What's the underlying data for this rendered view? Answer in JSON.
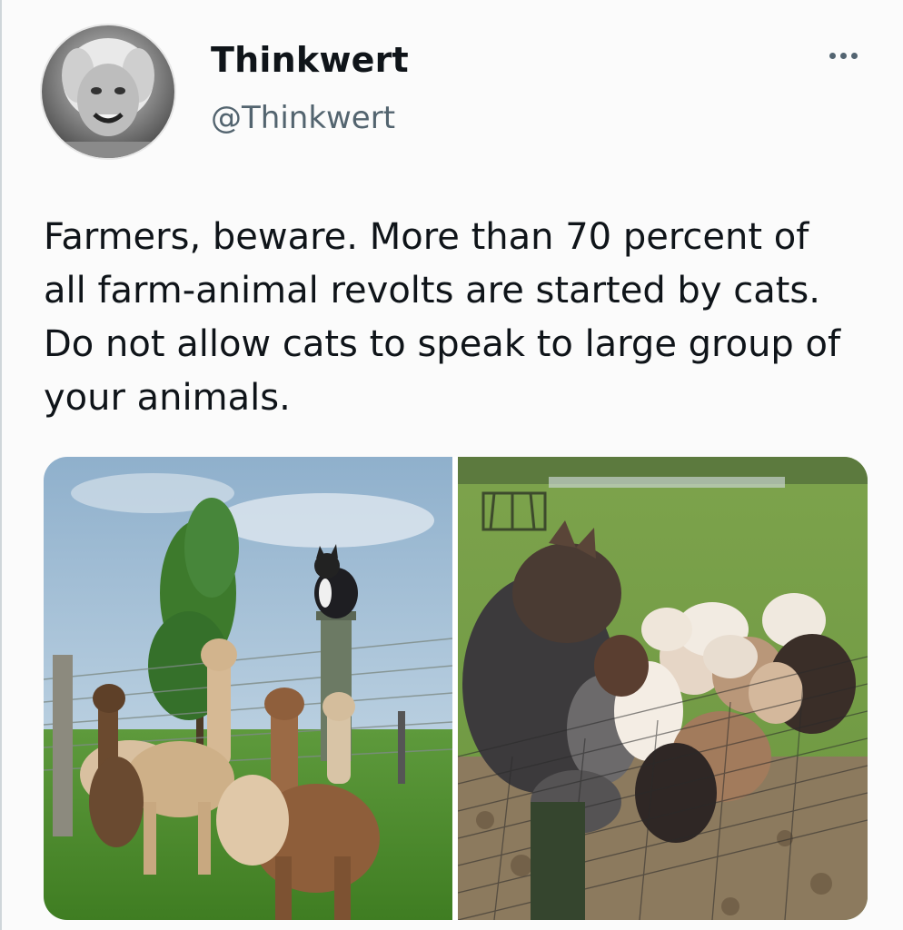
{
  "author": {
    "display_name": "Thinkwert",
    "handle": "@Thinkwert"
  },
  "tweet": {
    "text": "Farmers, beware.  More than 70 percent of all farm-animal revolts are started by cats. Do not allow cats to speak to large group of your animals."
  },
  "media": [
    {
      "scene": "cat-on-fence-post-with-alpacas"
    },
    {
      "scene": "cat-at-fence-with-sheep"
    }
  ],
  "icons": {
    "more": "more-options-icon"
  },
  "colors": {
    "text": "#0f1419",
    "secondary_text": "#536471",
    "background": "#fbfbfb"
  }
}
